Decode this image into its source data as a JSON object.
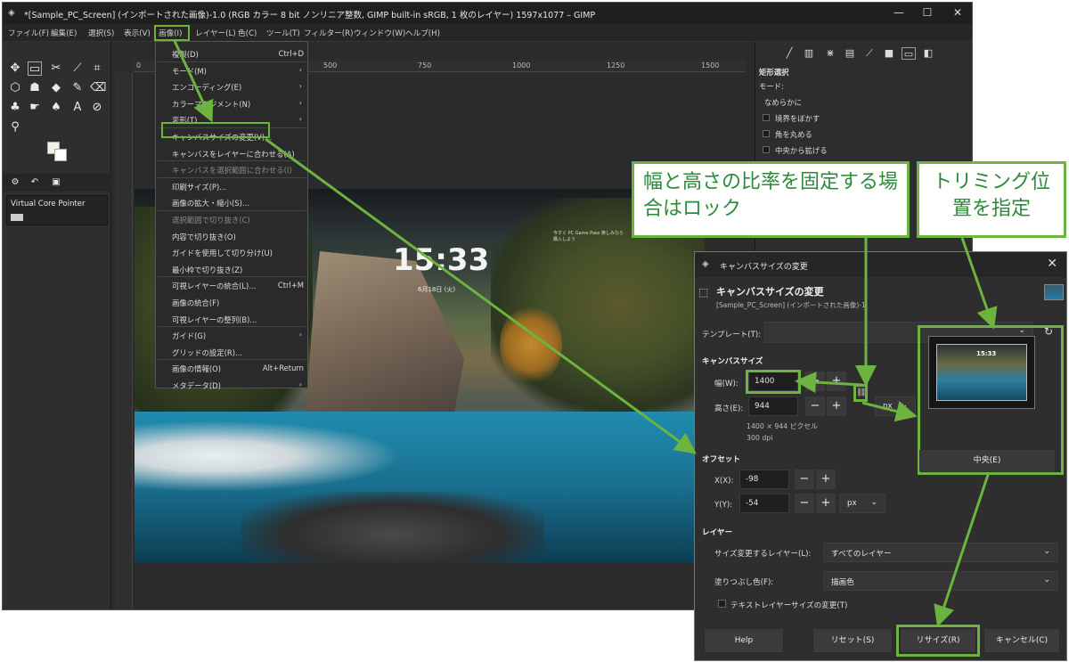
{
  "window": {
    "title": "*[Sample_PC_Screen] (インポートされた画像)-1.0 (RGB カラー 8 bit ノンリニア整数, GIMP built-in sRGB, 1 枚のレイヤー) 1597x1077 – GIMP",
    "minimize": "—",
    "maximize": "☐",
    "close": "✕"
  },
  "menubar": [
    "ファイル(F)",
    "編集(E)",
    "選択(S)",
    "表示(V)",
    "画像(I)",
    "レイヤー(L)",
    "色(C)",
    "ツール(T)",
    "フィルター(R)",
    "ウィンドウ(W)",
    "ヘルプ(H)"
  ],
  "toolbox": {
    "device": "Virtual Core Pointer"
  },
  "ruler": [
    "0",
    "500",
    "750",
    "1000",
    "1250",
    "1500"
  ],
  "image": {
    "clock": "15:33",
    "date": "6月18日 (火)",
    "corner": "今すぐ PC Game Pass 楽しみなら 購入しよう"
  },
  "image_menu": {
    "items": [
      {
        "label": "複製(D)",
        "shortcut": "Ctrl+D",
        "dim": false
      },
      {
        "label": "モード(M)",
        "shortcut": "›",
        "dim": false
      },
      {
        "label": "エンコーディング(E)",
        "shortcut": "›",
        "dim": false
      },
      {
        "label": "カラーマネジメント(N)",
        "shortcut": "›",
        "dim": false
      },
      {
        "label": "変形(T)",
        "shortcut": "›",
        "dim": false
      },
      {
        "label": "キャンバスサイズの変更(V)...",
        "shortcut": "",
        "dim": false
      },
      {
        "label": "キャンバスをレイヤーに合わせる(A)",
        "shortcut": "",
        "dim": false
      },
      {
        "label": "キャンバスを選択範囲に合わせる(I)",
        "shortcut": "",
        "dim": true
      },
      {
        "label": "印刷サイズ(P)...",
        "shortcut": "",
        "dim": false
      },
      {
        "label": "画像の拡大・縮小(S)...",
        "shortcut": "",
        "dim": false
      },
      {
        "label": "選択範囲で切り抜き(C)",
        "shortcut": "",
        "dim": true
      },
      {
        "label": "内容で切り抜き(O)",
        "shortcut": "",
        "dim": false
      },
      {
        "label": "ガイドを使用して切り分け(U)",
        "shortcut": "",
        "dim": false
      },
      {
        "label": "最小枠で切り抜き(Z)",
        "shortcut": "",
        "dim": false
      },
      {
        "label": "可視レイヤーの統合(L)...",
        "shortcut": "Ctrl+M",
        "dim": false
      },
      {
        "label": "画像の統合(F)",
        "shortcut": "",
        "dim": false
      },
      {
        "label": "可視レイヤーの整列(B)...",
        "shortcut": "",
        "dim": false
      },
      {
        "label": "ガイド(G)",
        "shortcut": "›",
        "dim": false
      },
      {
        "label": "グリッドの設定(R)...",
        "shortcut": "",
        "dim": false
      },
      {
        "label": "画像の情報(O)",
        "shortcut": "Alt+Return",
        "dim": false
      },
      {
        "label": "メタデータ(D)",
        "shortcut": "›",
        "dim": false
      }
    ]
  },
  "right_dock": {
    "title": "矩形選択",
    "mode": "モード:",
    "antialias": "なめらかに",
    "feather": "境界をぼかす",
    "rounded": "角を丸める",
    "expand": "中央から拡げる"
  },
  "callouts": {
    "lock": "幅と高さの比率を固定する場合はロック",
    "position": "トリミング位置を指定"
  },
  "dialog": {
    "title": "キャンバスサイズの変更",
    "heading": "キャンバスサイズの変更",
    "subheading": "[Sample_PC_Screen] (インポートされた画像)-1",
    "template_label": "テンプレート(T):",
    "canvas_size": "キャンバスサイズ",
    "width_label": "幅(W):",
    "width_value": "1400",
    "height_label": "高さ(E):",
    "height_value": "944",
    "size_info": "1400 × 944 ピクセル",
    "dpi": "300 dpi",
    "unit": "px",
    "offset": "オフセット",
    "x_label": "X(X):",
    "x_value": "-98",
    "y_label": "Y(Y):",
    "y_value": "-54",
    "offset_unit": "px",
    "preview_clock": "15:33",
    "center": "中央(E)",
    "layers": "レイヤー",
    "resize_layers_label": "サイズ変更するレイヤー(L):",
    "resize_layers_value": "すべてのレイヤー",
    "fill_label": "塗りつぶし色(F):",
    "fill_value": "描画色",
    "text_layers": "テキストレイヤーサイズの変更(T)",
    "help": "Help",
    "reset": "リセット(S)",
    "resize": "リサイズ(R)",
    "cancel": "キャンセル(C)"
  },
  "colors": {
    "accent_green": "#6db33f",
    "callout_text": "#2c8a3a"
  }
}
